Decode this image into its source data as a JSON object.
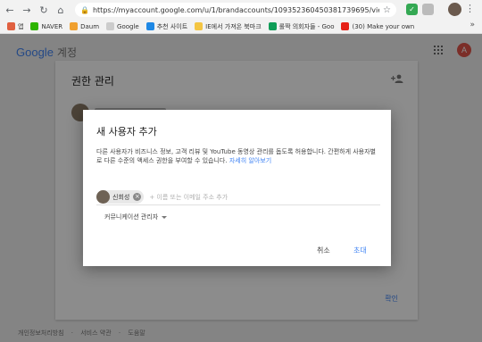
{
  "browser": {
    "url": "https://myaccount.google.com/u/1/brandaccounts/109352360450381739695/view",
    "bookmarks": [
      "앱",
      "NAVER",
      "Daum",
      "Google",
      "추천 사이트",
      "IE에서 가져온 북마크",
      "롤짝 의회자들 - Goo",
      "(30) Make your own"
    ],
    "more": "»"
  },
  "app": {
    "logo": "Google",
    "suffix": "계정",
    "avatar_letter": "A"
  },
  "card": {
    "title": "권한 관리",
    "confirm": "확인"
  },
  "footer": [
    "개인정보처리방침",
    "·",
    "서비스 약관",
    "·",
    "도움말"
  ],
  "dialog": {
    "title": "새 사용자 추가",
    "description": "다른 사용자가 비즈니스 정보, 고객 리뷰 및 YouTube 동영상 관리를 돕도록 허용합니다. 간편하게 사용자별로 다른 수준의 액세스 권한을 부여할 수 있습니다.",
    "learn_more": "자세히 알아보기",
    "chip_name": "신회성",
    "input_placeholder": "+ 이름 또는 이메일 주소 추가",
    "role": "커뮤니케이션 관리자",
    "cancel": "취소",
    "invite": "초대"
  },
  "colors": {
    "accent": "#4285f4",
    "avatar": "#e0544a"
  }
}
